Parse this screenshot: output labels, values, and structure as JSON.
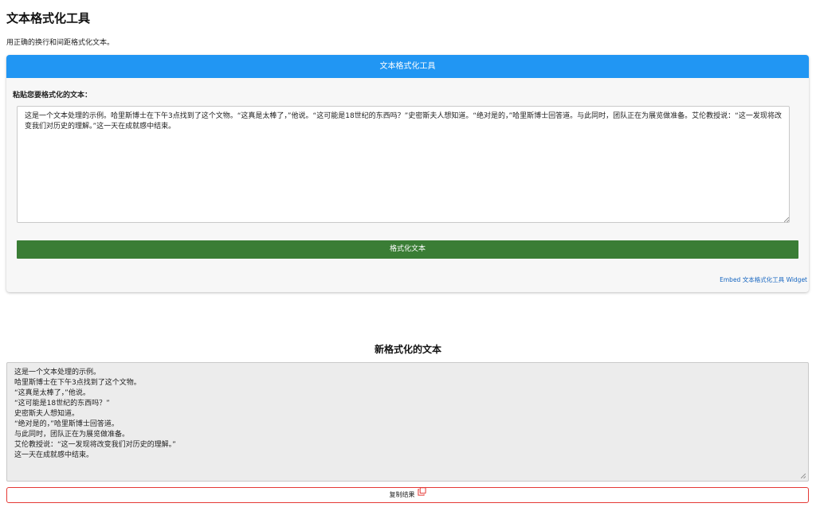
{
  "page": {
    "title": "文本格式化工具",
    "subtitle": "用正确的换行和间距格式化文本。"
  },
  "tool": {
    "header": "文本格式化工具",
    "input_label": "粘贴您要格式化的文本：",
    "input_value": "这是一个文本处理的示例。哈里斯博士在下午3点找到了这个文物。“这真是太棒了，”他说。“这可能是18世纪的东西吗？”史密斯夫人想知道。“绝对是的，”哈里斯博士回答道。与此同时，团队正在为展览做准备。艾伦教授说：“这一发现将改变我们对历史的理解。”这一天在成就感中结束。",
    "format_button": "格式化文本",
    "embed_link": "Embed 文本格式化工具 Widget"
  },
  "result": {
    "title": "新格式化的文本",
    "lines": [
      "这是一个文本处理的示例。",
      "哈里斯博士在下午3点找到了这个文物。",
      "“这真是太棒了，”他说。",
      "“这可能是18世纪的东西吗？”",
      "史密斯夫人想知道。",
      "“绝对是的，”哈里斯博士回答道。",
      "与此同时，团队正在为展览做准备。",
      "艾伦教授说：“这一发现将改变我们对历史的理解。”",
      "这一天在成就感中结束。"
    ],
    "copy_button": "复制结果",
    "copy_icon": "copy-icon"
  },
  "colors": {
    "header_bg": "#2196f3",
    "button_bg": "#3a7d35",
    "copy_border": "#e53935",
    "link": "#1565c0"
  }
}
